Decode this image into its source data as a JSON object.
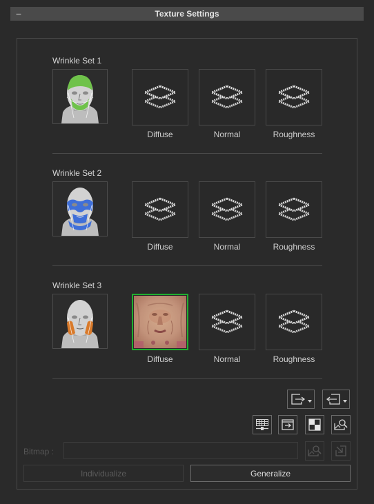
{
  "header": {
    "title": "Texture Settings",
    "collapse_glyph": "−"
  },
  "wrinkle_sets": [
    {
      "title": "Wrinkle Set 1",
      "face_icon": "face-green-forehead-icon",
      "slots": [
        "Diffuse",
        "Normal",
        "Roughness"
      ]
    },
    {
      "title": "Wrinkle Set 2",
      "face_icon": "face-blue-eyes-icon",
      "slots": [
        "Diffuse",
        "Normal",
        "Roughness"
      ]
    },
    {
      "title": "Wrinkle Set 3",
      "face_icon": "face-orange-cheeks-icon",
      "slots": [
        "Diffuse",
        "Normal",
        "Roughness"
      ]
    }
  ],
  "bitmap": {
    "label": "Bitmap :",
    "value": ""
  },
  "buttons": {
    "individualize": "Individualize",
    "generalize": "Generalize"
  },
  "colors": {
    "accent_selected": "#1fae2f",
    "mask_green": "#6fc24a",
    "mask_blue": "#3f6fd8",
    "mask_orange": "#d97a2a"
  }
}
